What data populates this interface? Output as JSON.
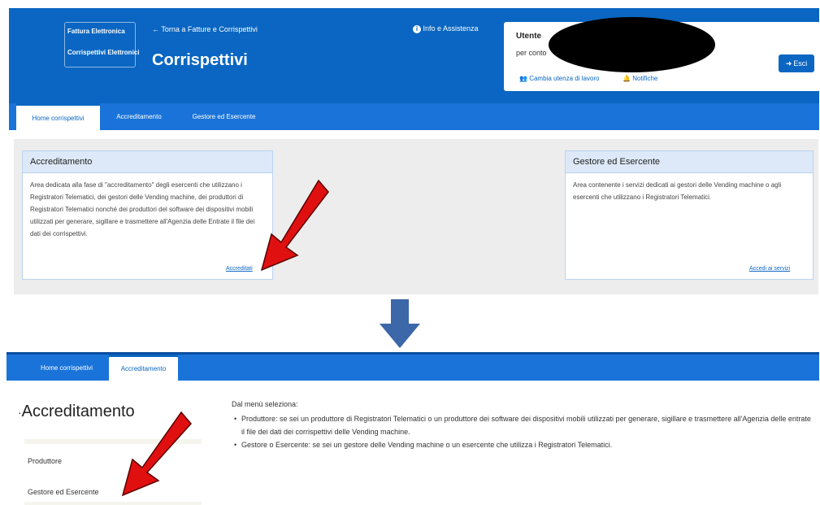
{
  "header": {
    "logo_line1": "Fattura Elettronica",
    "logo_line2": "Corrispettivi Elettronici",
    "back_link": "Torna a Fatture e Corrispettivi",
    "app_title": "Corrispettivi",
    "info_link": "Info e Assistenza",
    "user_label": "Utente",
    "per_conto": "per conto",
    "cambia_utenza": "Cambia utenza di lavoro",
    "notifiche": "Notifiche",
    "esci": "Esci"
  },
  "nav1": {
    "tabs": [
      {
        "label": "Home corrispettivi"
      },
      {
        "label": "Accreditamento"
      },
      {
        "label": "Gestore ed Esercente"
      }
    ]
  },
  "card_accreditamento": {
    "title": "Accreditamento",
    "body": "Area dedicata alla fase di \"accreditamento\" degli esercenti che utilizzano i Registratori Telematici, dei gestori delle Vending machine, dei produttori di Registratori Telematici nonché dei produttori del software dei dispositivi mobili utilizzati per generare, sigillare e trasmettere all'Agenzia delle Entrate il file dei dati dei corrispettivi.",
    "link": "Accreditati"
  },
  "card_gestore": {
    "title": "Gestore ed Esercente",
    "body": "Area contenente i servizi dedicati ai gestori delle Vending machine o agli esercenti che utilizzano i Registratori Telematici.",
    "link": "Accedi ai servizi"
  },
  "nav2": {
    "tabs": [
      {
        "label": "Home corrispettivi"
      },
      {
        "label": "Accreditamento"
      }
    ]
  },
  "accreditamento_page": {
    "title": "Accreditamento",
    "side_items": [
      {
        "label": "Produttore"
      },
      {
        "label": "Gestore ed Esercente"
      }
    ],
    "intro": "Dal menù seleziona:",
    "bullets": [
      {
        "text": "Produttore: se sei un produttore di Registratori Telematici o un produttore dei software dei dispositivi mobili utilizzati per generare, sigillare e trasmettere all'Agenzia delle entrate il file dei dati dei corrispettivi delle Vending machine."
      },
      {
        "text": "Gestore o Esercente: se sei un gestore delle Vending machine o un esercente che utilizza i Registratori Telematici."
      }
    ]
  },
  "colors": {
    "brand_blue": "#0a66c2",
    "nav_blue": "#1a73d8",
    "arrow_red": "#e01010",
    "arrow_blue": "#3c67a8"
  }
}
